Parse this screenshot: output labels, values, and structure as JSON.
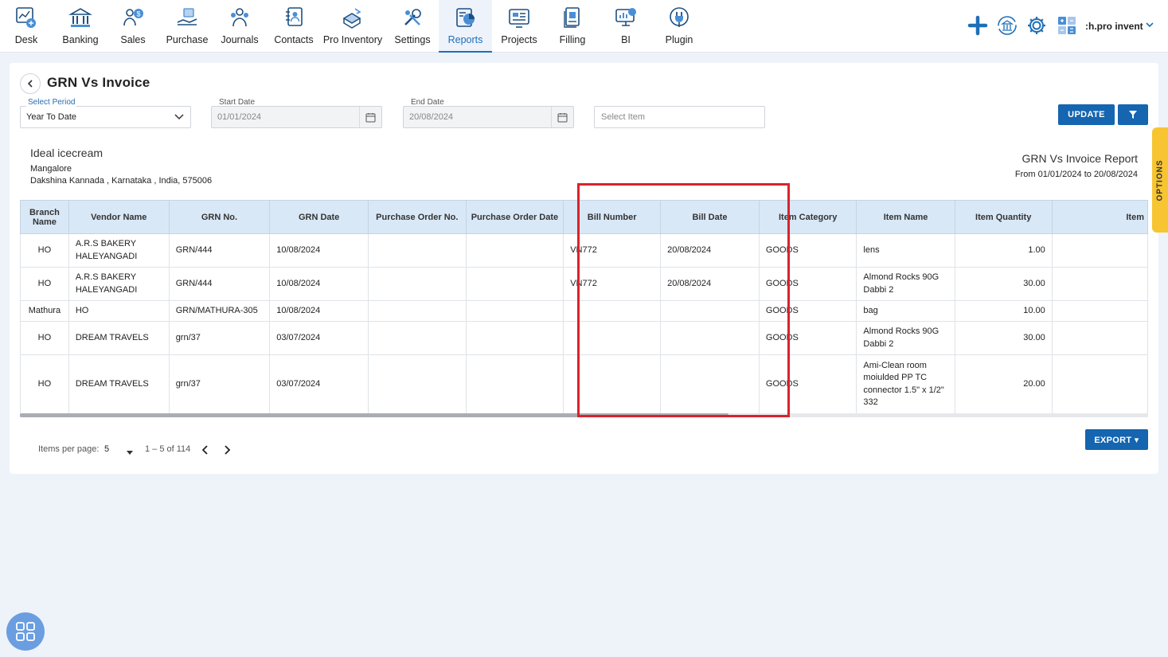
{
  "nav": {
    "items": [
      {
        "label": "Desk",
        "icon": "desk-icon"
      },
      {
        "label": "Banking",
        "icon": "bank-icon"
      },
      {
        "label": "Sales",
        "icon": "sales-icon"
      },
      {
        "label": "Purchase",
        "icon": "purchase-icon"
      },
      {
        "label": "Journals",
        "icon": "journals-icon"
      },
      {
        "label": "Contacts",
        "icon": "contacts-icon"
      },
      {
        "label": "Pro Inventory",
        "icon": "inventory-icon"
      },
      {
        "label": "Settings",
        "icon": "settings-tools-icon"
      },
      {
        "label": "Reports",
        "icon": "reports-icon",
        "active": true
      },
      {
        "label": "Projects",
        "icon": "projects-icon"
      },
      {
        "label": "Filling",
        "icon": "filling-icon"
      },
      {
        "label": "BI",
        "icon": "bi-icon"
      },
      {
        "label": "Plugin",
        "icon": "plugin-icon"
      }
    ],
    "company": ":h.pro invent",
    "accent": "#1d6fb8"
  },
  "page": {
    "title": "GRN Vs Invoice"
  },
  "filters": {
    "period_label": "Select Period",
    "period_value": "Year To Date",
    "start_label": "Start Date",
    "start_value": "01/01/2024",
    "end_label": "End Date",
    "end_value": "20/08/2024",
    "item_placeholder": "Select Item",
    "update_label": "UPDATE"
  },
  "options_label": "OPTIONS",
  "report": {
    "company_name": "Ideal icecream",
    "city": "Mangalore",
    "address": "Dakshina Kannada , Karnataka , India, 575006",
    "title": "GRN Vs Invoice Report",
    "range": "From 01/01/2024 to 20/08/2024"
  },
  "table": {
    "columns": [
      "Branch Name",
      "Vendor Name",
      "GRN No.",
      "GRN Date",
      "Purchase Order No.",
      "Purchase Order Date",
      "Bill Number",
      "Bill Date",
      "Item Category",
      "Item Name",
      "Item Quantity",
      "Item"
    ],
    "rows": [
      [
        "HO",
        "A.R.S BAKERY HALEYANGADI",
        "GRN/444",
        "10/08/2024",
        "",
        "",
        "VN772",
        "20/08/2024",
        "GOODS",
        "lens",
        "1.00",
        ""
      ],
      [
        "HO",
        "A.R.S BAKERY HALEYANGADI",
        "GRN/444",
        "10/08/2024",
        "",
        "",
        "VN772",
        "20/08/2024",
        "GOODS",
        "Almond Rocks 90G Dabbi 2",
        "30.00",
        ""
      ],
      [
        "Mathura",
        "HO",
        "GRN/MATHURA-305",
        "10/08/2024",
        "",
        "",
        "",
        "",
        "GOODS",
        "bag",
        "10.00",
        ""
      ],
      [
        "HO",
        "DREAM TRAVELS",
        "grn/37",
        "03/07/2024",
        "",
        "",
        "",
        "",
        "GOODS",
        "Almond Rocks 90G Dabbi 2",
        "30.00",
        ""
      ],
      [
        "HO",
        "DREAM TRAVELS",
        "grn/37",
        "03/07/2024",
        "",
        "",
        "",
        "",
        "GOODS",
        "Ami-Clean room moiulded PP TC connector 1.5\" x 1/2\" 332",
        "20.00",
        ""
      ]
    ],
    "header_bg": "#d9e8f7"
  },
  "pager": {
    "label": "Items per page:",
    "size": "5",
    "range": "1 – 5 of 114"
  },
  "export_label": "EXPORT ▾",
  "highlight_color": "#d9232d"
}
